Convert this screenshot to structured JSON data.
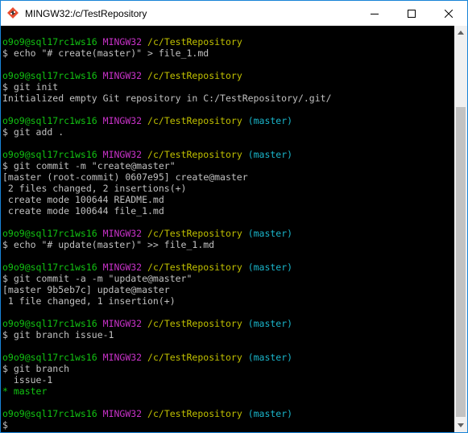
{
  "window": {
    "title": "MINGW32:/c/TestRepository",
    "icon": "git-bash-icon",
    "controls": {
      "minimize_icon": "minimize-icon",
      "maximize_icon": "maximize-icon",
      "close_icon": "close-icon"
    }
  },
  "colors": {
    "user_host": "#12c312",
    "mingw": "#c832c8",
    "path": "#c0c000",
    "branch": "#1ab6cb",
    "output": "#c0c0c0",
    "current_branch": "#12c312"
  },
  "terminal": {
    "lines": [
      {
        "type": "prompt",
        "user": "o9o9@sql17rc1ws16",
        "env": "MINGW32",
        "path": "/c/TestRepository",
        "branch": ""
      },
      {
        "type": "cmd",
        "text": "$ echo \"# create(master)\" > file_1.md"
      },
      {
        "type": "blank"
      },
      {
        "type": "prompt",
        "user": "o9o9@sql17rc1ws16",
        "env": "MINGW32",
        "path": "/c/TestRepository",
        "branch": ""
      },
      {
        "type": "cmd",
        "text": "$ git init"
      },
      {
        "type": "out",
        "text": "Initialized empty Git repository in C:/TestRepository/.git/"
      },
      {
        "type": "blank"
      },
      {
        "type": "prompt",
        "user": "o9o9@sql17rc1ws16",
        "env": "MINGW32",
        "path": "/c/TestRepository",
        "branch": "(master)"
      },
      {
        "type": "cmd",
        "text": "$ git add ."
      },
      {
        "type": "blank"
      },
      {
        "type": "prompt",
        "user": "o9o9@sql17rc1ws16",
        "env": "MINGW32",
        "path": "/c/TestRepository",
        "branch": "(master)"
      },
      {
        "type": "cmd",
        "text": "$ git commit -m \"create@master\""
      },
      {
        "type": "out",
        "text": "[master (root-commit) 0607e95] create@master"
      },
      {
        "type": "out",
        "text": " 2 files changed, 2 insertions(+)"
      },
      {
        "type": "out",
        "text": " create mode 100644 README.md"
      },
      {
        "type": "out",
        "text": " create mode 100644 file_1.md"
      },
      {
        "type": "blank"
      },
      {
        "type": "prompt",
        "user": "o9o9@sql17rc1ws16",
        "env": "MINGW32",
        "path": "/c/TestRepository",
        "branch": "(master)"
      },
      {
        "type": "cmd",
        "text": "$ echo \"# update(master)\" >> file_1.md"
      },
      {
        "type": "blank"
      },
      {
        "type": "prompt",
        "user": "o9o9@sql17rc1ws16",
        "env": "MINGW32",
        "path": "/c/TestRepository",
        "branch": "(master)"
      },
      {
        "type": "cmd",
        "text": "$ git commit -a -m \"update@master\""
      },
      {
        "type": "out",
        "text": "[master 9b5eb7c] update@master"
      },
      {
        "type": "out",
        "text": " 1 file changed, 1 insertion(+)"
      },
      {
        "type": "blank"
      },
      {
        "type": "prompt",
        "user": "o9o9@sql17rc1ws16",
        "env": "MINGW32",
        "path": "/c/TestRepository",
        "branch": "(master)"
      },
      {
        "type": "cmd",
        "text": "$ git branch issue-1"
      },
      {
        "type": "blank"
      },
      {
        "type": "prompt",
        "user": "o9o9@sql17rc1ws16",
        "env": "MINGW32",
        "path": "/c/TestRepository",
        "branch": "(master)"
      },
      {
        "type": "cmd",
        "text": "$ git branch"
      },
      {
        "type": "out",
        "text": "  issue-1"
      },
      {
        "type": "current",
        "text": "* master"
      },
      {
        "type": "blank"
      },
      {
        "type": "prompt",
        "user": "o9o9@sql17rc1ws16",
        "env": "MINGW32",
        "path": "/c/TestRepository",
        "branch": "(master)"
      },
      {
        "type": "cursor",
        "text": "$"
      }
    ]
  },
  "scrollbar": {
    "up_icon": "scroll-up-arrow-icon",
    "down_icon": "scroll-down-arrow-icon",
    "position": 1.0
  }
}
